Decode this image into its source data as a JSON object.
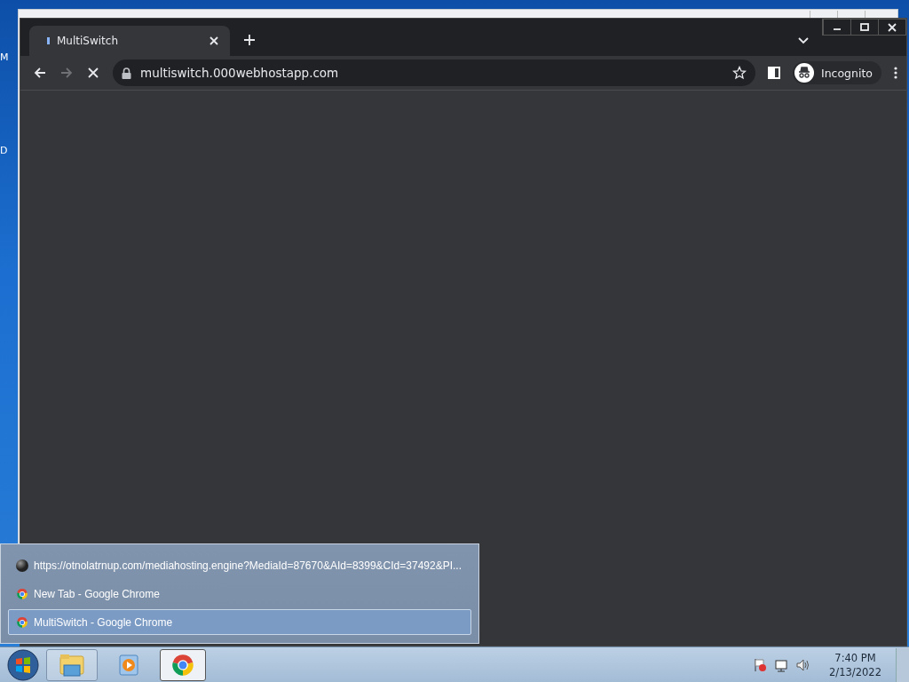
{
  "desktop": {
    "edge_labels": [
      "M",
      "D"
    ]
  },
  "browser": {
    "tabs": [
      {
        "title": "MultiSwitch",
        "selected": true,
        "loading": true
      }
    ],
    "toolbar": {
      "back_enabled": true,
      "forward_enabled": false,
      "loading": true
    },
    "address": "multiswitch.000webhostapp.com",
    "profile": "Incognito"
  },
  "jump_list": {
    "items": [
      {
        "kind": "web",
        "title": "https://otnolatrnup.com/mediahosting.engine?MediaId=87670&AId=8399&CId=37492&PI...",
        "selected": false
      },
      {
        "kind": "chrome",
        "title": "New Tab - Google Chrome",
        "selected": false
      },
      {
        "kind": "chrome",
        "title": "MultiSwitch - Google Chrome",
        "selected": true
      }
    ]
  },
  "taskbar": {
    "apps": [
      {
        "kind": "explorer",
        "running": true,
        "selected": false
      },
      {
        "kind": "media-player",
        "running": false,
        "selected": false
      },
      {
        "kind": "chrome",
        "running": true,
        "selected": true
      }
    ],
    "clock": {
      "time": "7:40 PM",
      "date": "2/13/2022"
    }
  }
}
